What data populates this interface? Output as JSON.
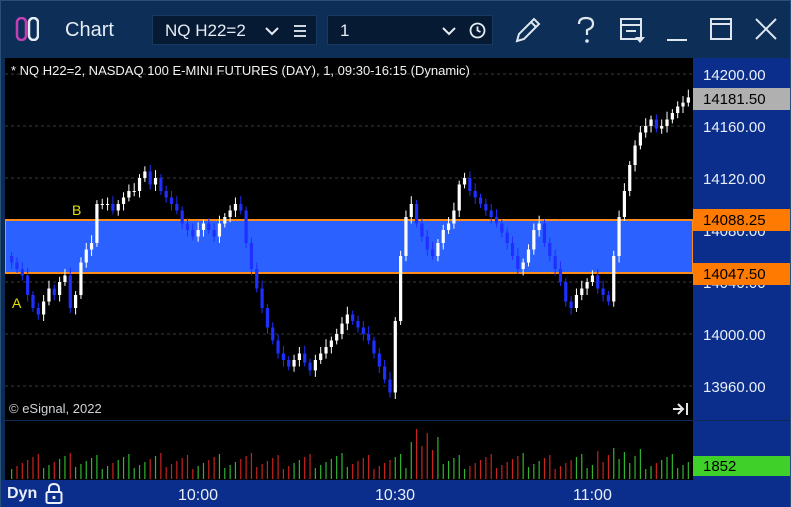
{
  "window": {
    "title": "Chart",
    "symbol": "NQ H22=2",
    "interval": "1"
  },
  "chart": {
    "header": "* NQ H22=2, NASDAQ 100 E-MINI FUTURES (DAY), 1, 09:30-16:15 (Dynamic)",
    "copyright": "© eSignal, 2022",
    "label_a": "A",
    "label_b": "B",
    "price_labels": [
      "14200.00",
      "14160.00",
      "14120.00",
      "14080.00",
      "14040.00",
      "14000.00",
      "13960.00"
    ],
    "last_price": "14181.50",
    "upper_band": "14088.25",
    "lower_band": "14047.50",
    "volume": "1852",
    "time_labels": [
      "10:00",
      "10:30",
      "11:00"
    ],
    "status": "Dyn",
    "colors": {
      "band": "#2b62ff",
      "band_border": "#ff8c1a",
      "up_candle": "#ffffff",
      "down_candle": "#1f2fff",
      "last_price_box": "#b0b0b0",
      "band_price_box": "#ff7a00",
      "volume_box": "#3fd12a",
      "axis_bg": "#0b2e8c"
    }
  }
}
